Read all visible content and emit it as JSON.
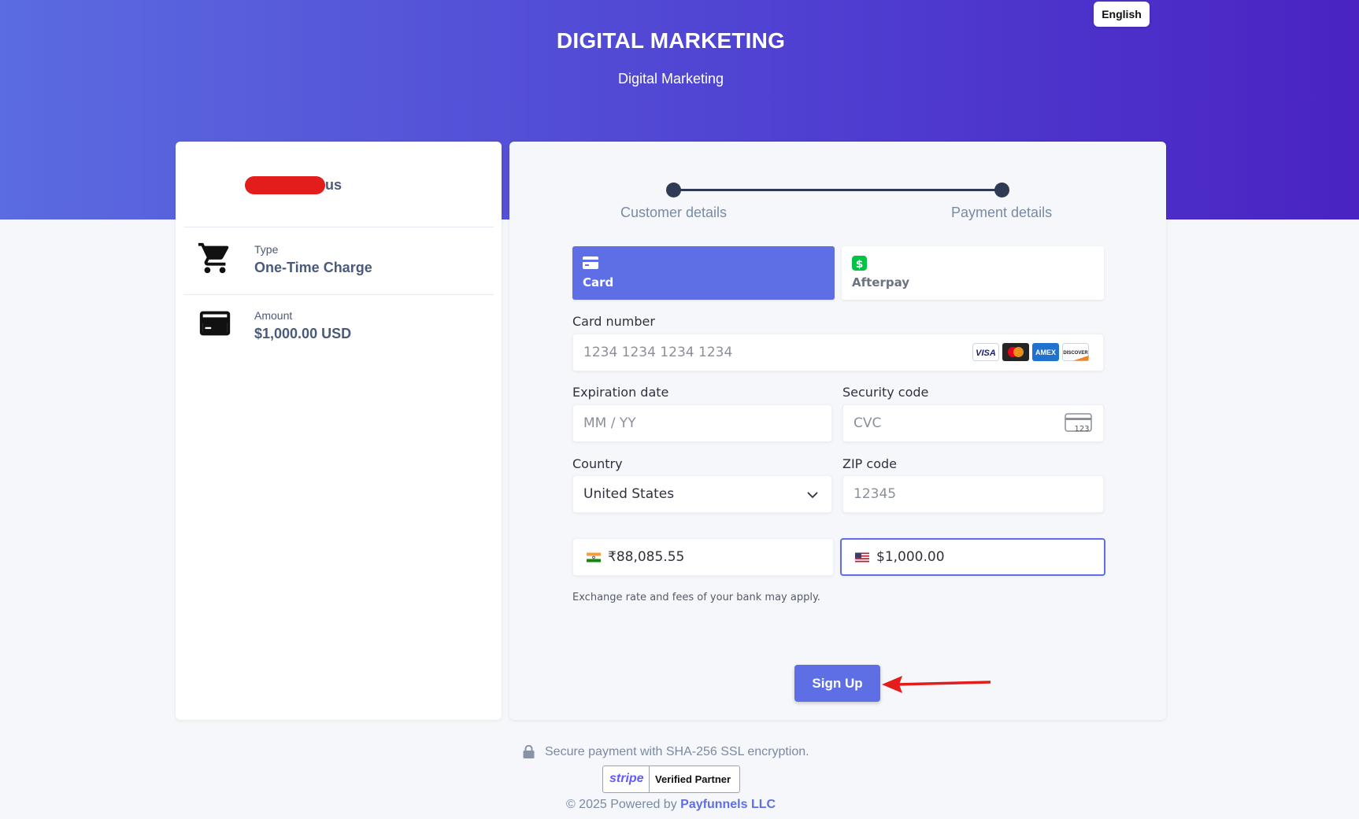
{
  "header": {
    "language_button": "English",
    "title": "DIGITAL MARKETING",
    "subtitle": "Digital Marketing"
  },
  "summary": {
    "merchant_visible_suffix": "us",
    "type_label": "Type",
    "type_value": "One-Time Charge",
    "amount_label": "Amount",
    "amount_value": "$1,000.00 USD",
    "icons": [
      "cart-icon",
      "credit-card-icon"
    ]
  },
  "steps": [
    {
      "label": "Customer details"
    },
    {
      "label": "Payment details"
    }
  ],
  "payment_tabs": [
    {
      "label": "Card",
      "selected": true,
      "icon": "card-icon"
    },
    {
      "label": "Afterpay",
      "selected": false,
      "icon": "dollar-icon"
    }
  ],
  "form": {
    "card_number_label": "Card number",
    "card_number_placeholder": "1234 1234 1234 1234",
    "card_brands": [
      "VISA",
      "Mastercard",
      "AMEX",
      "DISCOVER"
    ],
    "expiry_label": "Expiration date",
    "expiry_placeholder": "MM / YY",
    "cvc_label": "Security code",
    "cvc_placeholder": "CVC",
    "cvc_icon_text": "123",
    "country_label": "Country",
    "country_value": "United States",
    "zip_label": "ZIP code",
    "zip_placeholder": "12345"
  },
  "currency": {
    "inr_value": "₹88,085.55",
    "usd_value": "$1,000.00",
    "selected": "USD",
    "note": "Exchange rate and fees of your bank may apply."
  },
  "actions": {
    "signup_label": "Sign Up"
  },
  "footer": {
    "secure_text": "Secure payment with SHA-256 SSL encryption.",
    "stripe_word": "stripe",
    "verified_partner": "Verified Partner",
    "powered_prefix": "© 2025 Powered by",
    "powered_link": "Payfunnels LLC"
  },
  "colors": {
    "accent": "#5e6fe6",
    "hero_start": "#5b6be0",
    "hero_end": "#4a23c2",
    "annotation_arrow": "#e31c1c",
    "redaction": "#e31c1c"
  }
}
